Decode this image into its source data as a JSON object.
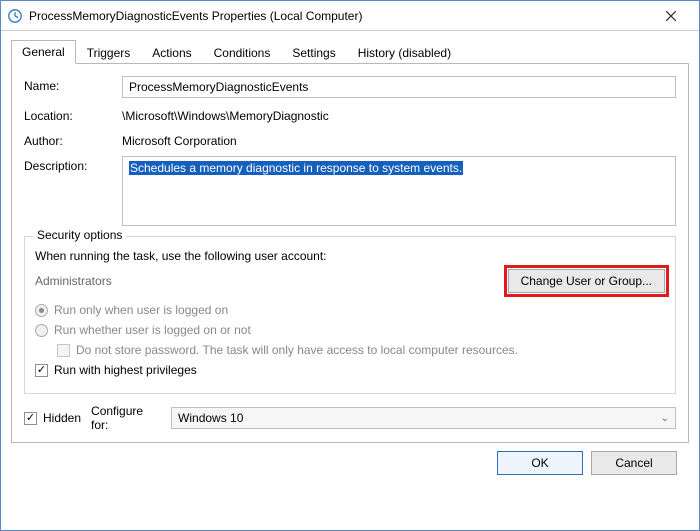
{
  "window": {
    "title": "ProcessMemoryDiagnosticEvents Properties (Local Computer)"
  },
  "tabs": {
    "general": "General",
    "triggers": "Triggers",
    "actions": "Actions",
    "conditions": "Conditions",
    "settings": "Settings",
    "history": "History (disabled)"
  },
  "labels": {
    "name": "Name:",
    "location": "Location:",
    "author": "Author:",
    "description": "Description:",
    "security_legend": "Security options",
    "when_running": "When running the task, use the following user account:",
    "change_user": "Change User or Group...",
    "run_logged_on": "Run only when user is logged on",
    "run_whether": "Run whether user is logged on or not",
    "no_store_pw": "Do not store password.  The task will only have access to local computer resources.",
    "run_highest": "Run with highest privileges",
    "hidden": "Hidden",
    "configure_for": "Configure for:",
    "ok": "OK",
    "cancel": "Cancel"
  },
  "values": {
    "name": "ProcessMemoryDiagnosticEvents",
    "location": "\\Microsoft\\Windows\\MemoryDiagnostic",
    "author": "Microsoft Corporation",
    "description": "Schedules a memory diagnostic in response to system events.",
    "account": "Administrators",
    "configure_for": "Windows 10"
  }
}
